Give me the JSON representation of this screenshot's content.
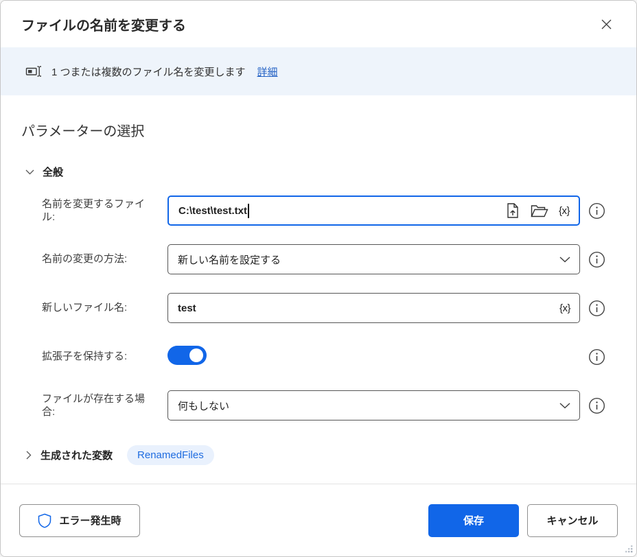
{
  "colors": {
    "accent": "#1166e8",
    "banner_bg": "#eef4fb",
    "pill_bg": "#e9f1fd",
    "pill_text": "#1f6ce0",
    "link": "#2160c4"
  },
  "dialog": {
    "title": "ファイルの名前を変更する"
  },
  "banner": {
    "text": "1 つまたは複数のファイル名を変更します",
    "link_label": "詳細"
  },
  "main": {
    "heading": "パラメーターの選択",
    "general_section_label": "全般",
    "fields": [
      {
        "label": "名前を変更するファイル:",
        "value": "C:\\test\\test.txt",
        "variable_icon": "{x}"
      },
      {
        "label": "名前の変更の方法:",
        "value": "新しい名前を設定する"
      },
      {
        "label": "新しいファイル名:",
        "value": "test",
        "variable_icon": "{x}"
      },
      {
        "label": "拡張子を保持する:",
        "toggle_state": "on"
      },
      {
        "label": "ファイルが存在する場合:",
        "value": "何もしない"
      }
    ],
    "produced_variables": {
      "label": "生成された変数",
      "variable": "RenamedFiles"
    }
  },
  "footer": {
    "on_error_label": "エラー発生時",
    "save_label": "保存",
    "cancel_label": "キャンセル"
  }
}
